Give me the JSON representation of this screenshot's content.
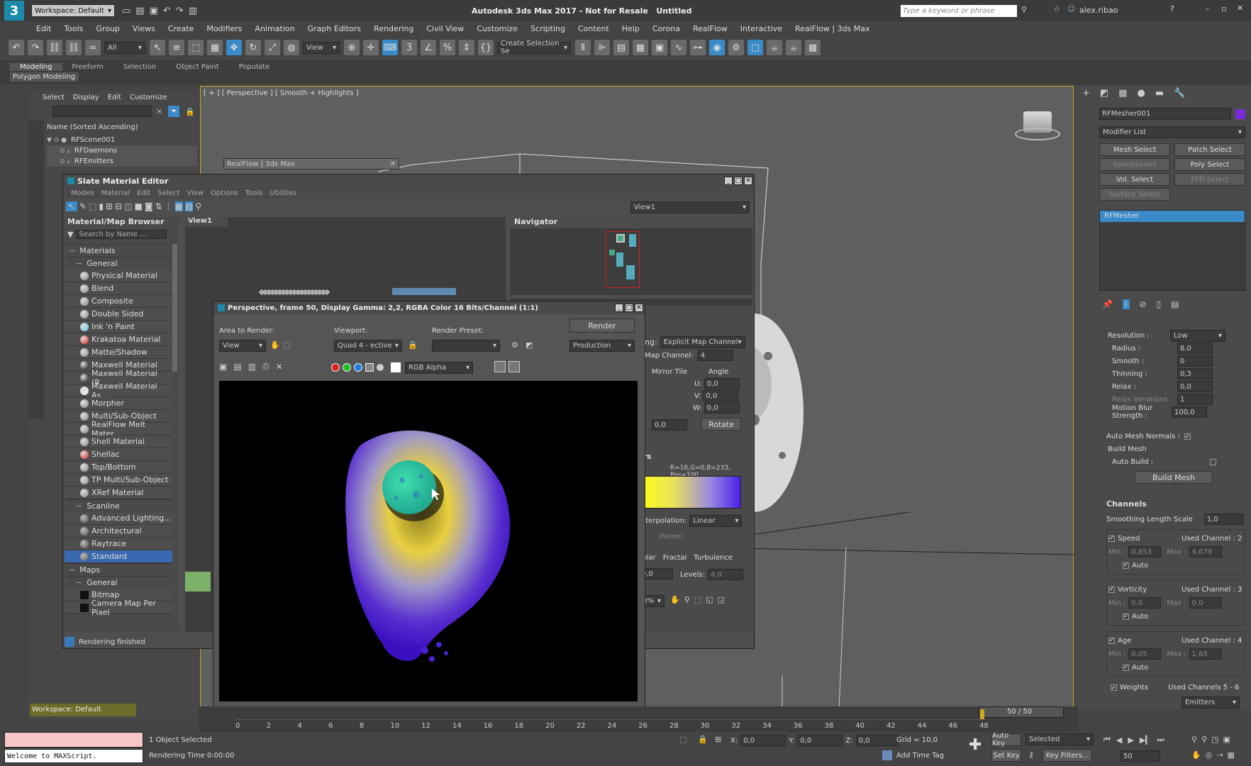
{
  "app": {
    "title": "Autodesk 3ds Max 2017 - Not for Resale",
    "doc": "Untitled",
    "workspace": "Workspace: Default",
    "search_placeholder": "Type a keyword or phrase",
    "user": "alex.ribao"
  },
  "menu": [
    "Edit",
    "Tools",
    "Group",
    "Views",
    "Create",
    "Modifiers",
    "Animation",
    "Graph Editors",
    "Rendering",
    "Civil View",
    "Customize",
    "Scripting",
    "Content",
    "Help",
    "Corona",
    "RealFlow",
    "Interactive",
    "RealFlow | 3ds Max"
  ],
  "toolbar": {
    "filter": "All",
    "view": "View",
    "selection_set": "Create Selection Se"
  },
  "ribbon": {
    "tabs": [
      "Modeling",
      "Freeform",
      "Selection",
      "Object Paint",
      "Populate"
    ],
    "sub": "Polygon Modeling"
  },
  "scene_explorer": {
    "tabs": [
      "Select",
      "Display",
      "Edit",
      "Customize"
    ],
    "header": "Name (Sorted Ascending)",
    "items": [
      "RFScene001",
      "RFDaemons",
      "RFEmitters"
    ]
  },
  "viewport": {
    "label": "[ + ] [ Perspective ] [ Smooth + Highlights ]"
  },
  "realflow_panel": {
    "title": "RealFlow | 3ds Max"
  },
  "slate": {
    "title": "Slate Material Editor",
    "menu": [
      "Modes",
      "Material",
      "Edit",
      "Select",
      "View",
      "Options",
      "Tools",
      "Utilities"
    ],
    "view_dd": "View1",
    "browser_title": "Material/Map Browser",
    "search": "Search by Name ...",
    "view_tab": "View1",
    "navigator": "Navigator",
    "status": "Rendering finished",
    "materials_header": "Materials",
    "general": "General",
    "materials": [
      {
        "name": "Physical Material",
        "c": "#888"
      },
      {
        "name": "Blend",
        "c": "#888"
      },
      {
        "name": "Composite",
        "c": "#888"
      },
      {
        "name": "Double Sided",
        "c": "#888"
      },
      {
        "name": "Ink 'n Paint",
        "c": "#5bc8ea"
      },
      {
        "name": "Krakatoa Material",
        "c": "#e02020"
      },
      {
        "name": "Matte/Shadow",
        "c": "#888"
      },
      {
        "name": "Maxwell Material",
        "c": "#111"
      },
      {
        "name": "Maxwell Material (R...",
        "c": "#111"
      },
      {
        "name": "Maxwell Material As...",
        "c": "#eee"
      },
      {
        "name": "Morpher",
        "c": "#888"
      },
      {
        "name": "Multi/Sub-Object",
        "c": "#888"
      },
      {
        "name": "RealFlow Melt Mater...",
        "c": "#888"
      },
      {
        "name": "Shell Material",
        "c": "#888"
      },
      {
        "name": "Shellac",
        "c": "#e02020"
      },
      {
        "name": "Top/Bottom",
        "c": "#888"
      },
      {
        "name": "TP Multi/Sub-Object",
        "c": "#888"
      },
      {
        "name": "XRef Material",
        "c": "#888"
      }
    ],
    "scanline": "Scanline",
    "scanline_items": [
      "Advanced Lighting...",
      "Architectural",
      "Raytrace",
      "Standard"
    ],
    "maps": "Maps",
    "maps_general": "General",
    "map_items": [
      "Bitmap",
      "Camera Map Per Pixel"
    ]
  },
  "params": {
    "mapping_label": "ping:",
    "mapping": "Explicit Map Channel",
    "map_channel_label": "Map Channel:",
    "map_channel": "4",
    "mirror_tile": "Mirror Tile",
    "angle": "Angle",
    "u": "U:",
    "u_val": "0,0",
    "v": "V:",
    "v_val": "0,0",
    "w": "W:",
    "w_val": "0,0",
    "blur": "0,0",
    "rotate": "Rotate",
    "colors_header": "ers",
    "rgb_readout": "R=16,G=0,B=233, Pos=100",
    "interp_label": "Interpolation:",
    "interp": "Linear",
    "none": "(None)",
    "regular": "gular",
    "fractal": "Fractal",
    "turbulence": "Turbulence",
    "noise_val": "0,0",
    "levels_label": "Levels:",
    "levels": "4,0",
    "zoom": "78%"
  },
  "frame_window": {
    "title": "Perspective, frame 50, Display Gamma: 2,2, RGBA Color 16 Bits/Channel (1:1)",
    "area_label": "Area to Render:",
    "area": "View",
    "viewport_label": "Viewport:",
    "viewport": "Quad 4 - ective",
    "preset_label": "Render Preset:",
    "preset": "",
    "render": "Render",
    "production": "Production",
    "channel": "RGB Alpha"
  },
  "command_panel": {
    "object": "RFMesher001",
    "color": "#7a2ad8",
    "modifier_list": "Modifier List",
    "buttons": [
      [
        "Mesh Select",
        "Patch Select"
      ],
      [
        "SplineSelect",
        "Poly Select"
      ],
      [
        "Vol. Select",
        "FFD Select"
      ],
      [
        "Surface Select",
        ""
      ]
    ],
    "stack": "RFMesher",
    "params": [
      {
        "l": "Resolution :",
        "v": "Low",
        "dd": true
      },
      {
        "l": "Radius :",
        "v": "8,0"
      },
      {
        "l": "Smooth :",
        "v": "0"
      },
      {
        "l": "Thinning :",
        "v": "0,3"
      },
      {
        "l": "Relax :",
        "v": "0,0"
      },
      {
        "l": "Relax Iterations",
        "v": "1"
      },
      {
        "l": "Motion Blur Strength :",
        "v": "100,0"
      }
    ],
    "auto_normals": "Auto Mesh Normals :",
    "build_mesh": "Build Mesh",
    "auto_build": "Auto Build :",
    "build_btn": "Build Mesh",
    "channels": "Channels",
    "smoothing": "Smoothing Length Scale",
    "smoothing_v": "1,0",
    "channel_groups": [
      {
        "name": "Speed",
        "used": "Used Channel : 2",
        "min": "0,853",
        "max": "4,679"
      },
      {
        "name": "Vorticity",
        "used": "Used Channel : 3",
        "min": "0,0",
        "max": "0,0"
      },
      {
        "name": "Age",
        "used": "Used Channel : 4",
        "min": "0,05",
        "max": "1,65"
      }
    ],
    "weights": "Weights",
    "weights_used": "Used Channels 5 - 6",
    "emitters": "Emitters",
    "auto": "Auto",
    "min": "Min :",
    "max": "Max :"
  },
  "timeline": {
    "frame": "50 / 50",
    "ticks": [
      "0",
      "2",
      "4",
      "6",
      "8",
      "10",
      "12",
      "14",
      "16",
      "18",
      "20",
      "22",
      "24",
      "26",
      "28",
      "30",
      "32",
      "34",
      "36",
      "38",
      "40",
      "42",
      "44",
      "46",
      "48"
    ],
    "progress": 1.0
  },
  "status": {
    "maxscript": "Welcome to MAXScript.",
    "selected": "1 Object Selected",
    "time": "Rendering Time 0:00:00",
    "x": "0,0",
    "y": "0,0",
    "z": "0,0",
    "grid": "Grid = 10,0",
    "add_tag": "Add Time Tag",
    "autokey": "Auto Key",
    "setkey": "Set Key",
    "sel": "Selected",
    "keyfilters": "Key Filters...",
    "frame": "50",
    "workspace": "Workspace: Default"
  }
}
